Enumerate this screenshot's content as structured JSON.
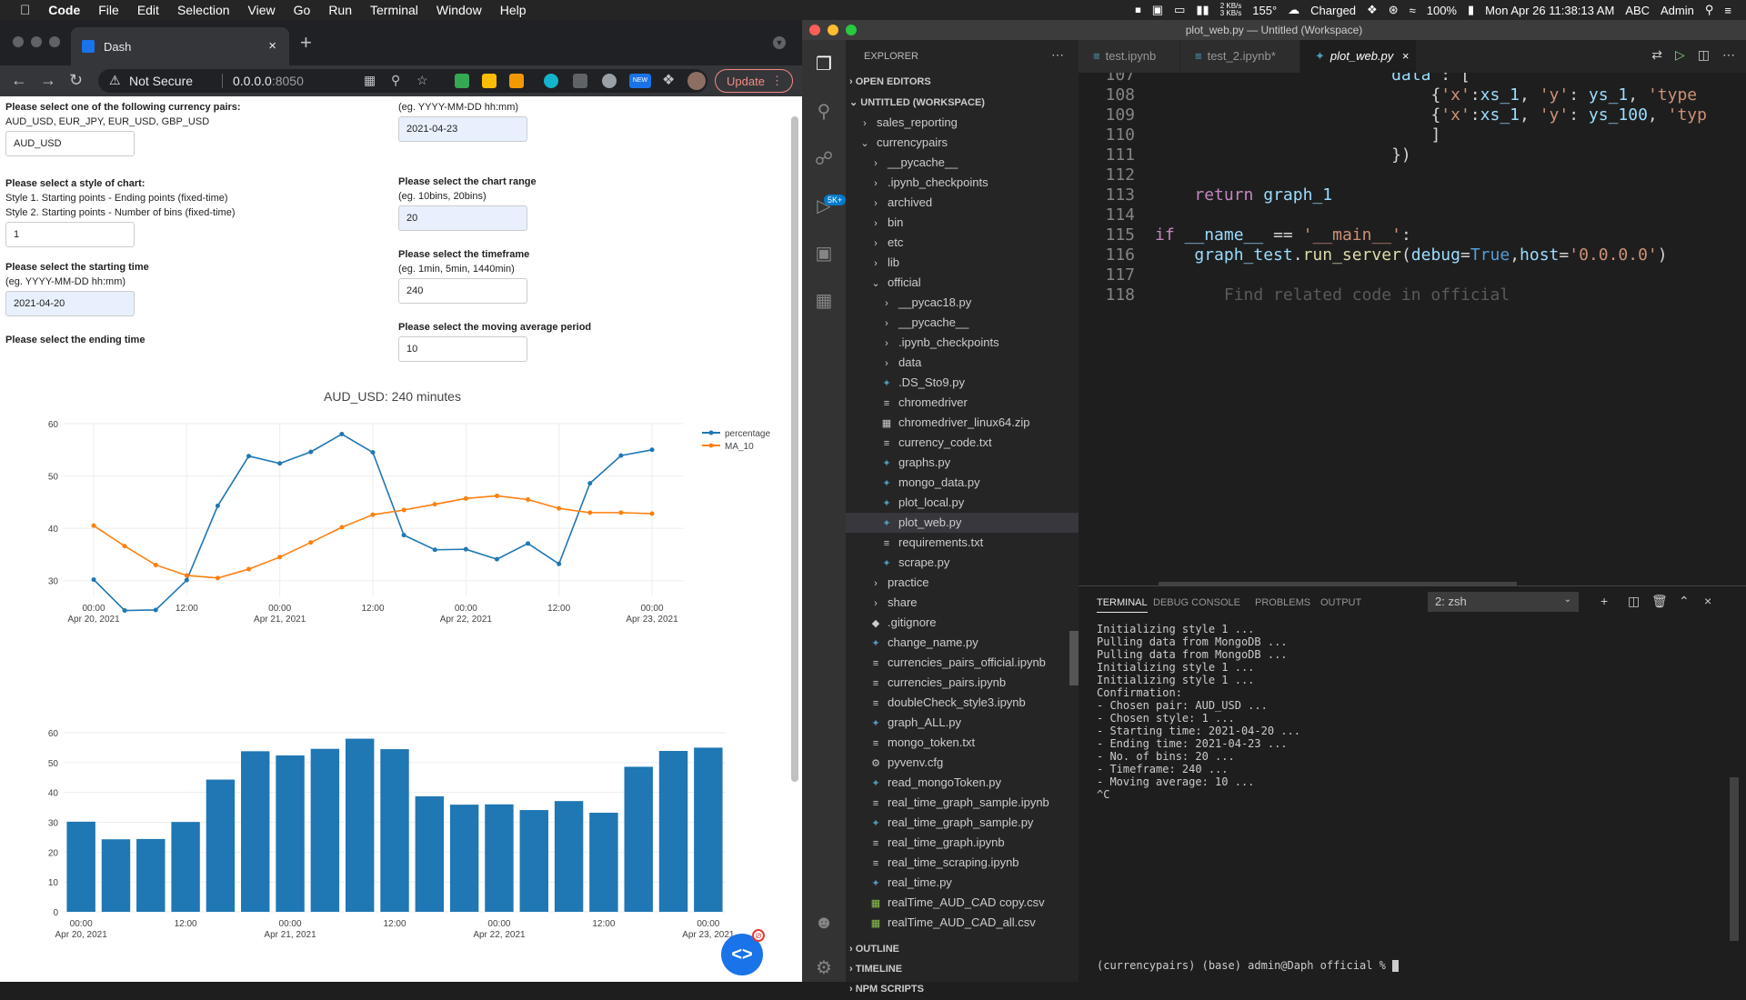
{
  "menubar": {
    "app": "Code",
    "items": [
      "File",
      "Edit",
      "Selection",
      "View",
      "Go",
      "Run",
      "Terminal",
      "Window",
      "Help"
    ],
    "right": {
      "net_up": "2 KB/s",
      "net_down": "3 KB/s",
      "temp": "155°",
      "charged": "Charged",
      "battery": "100%",
      "datetime": "Mon Apr 26  11:38:13 AM",
      "input_source": "ABC",
      "user": "Admin"
    }
  },
  "chrome": {
    "tab_title": "Dash",
    "omnibox": {
      "security": "Not Secure",
      "host": "0.0.0.0",
      "port": ":8050"
    },
    "update_label": "Update",
    "new_badge": "NEW"
  },
  "dash": {
    "currency_label": "Please select one of the following currency pairs:",
    "currency_hint": "AUD_USD, EUR_JPY, EUR_USD, GBP_USD",
    "currency_value": "AUD_USD",
    "style_label": "Please select a style of chart:",
    "style_hint1": "Style 1. Starting points - Ending points (fixed-time)",
    "style_hint2": "Style 2. Starting points - Number of bins (fixed-time)",
    "style_value": "1",
    "start_label": "Please select the starting time",
    "start_hint": "(eg. YYYY-MM-DD hh:mm)",
    "start_value": "2021-04-20",
    "end_label": "Please select the ending time",
    "end_hint": "(eg. YYYY-MM-DD hh:mm)",
    "end_value": "2021-04-23",
    "range_label": "Please select the chart range",
    "range_hint": "(eg. 10bins, 20bins)",
    "range_value": "20",
    "timeframe_label": "Please select the timeframe",
    "timeframe_hint": "(eg. 1min, 5min, 1440min)",
    "timeframe_value": "240",
    "ma_label": "Please select the moving average period",
    "ma_value": "10"
  },
  "chart_data": [
    {
      "type": "line",
      "title": "AUD_USD: 240 minutes",
      "x_hours": [
        "Apr 20 00:00",
        "Apr 20 04:00",
        "Apr 20 08:00",
        "Apr 20 12:00",
        "Apr 20 16:00",
        "Apr 20 20:00",
        "Apr 21 00:00",
        "Apr 21 04:00",
        "Apr 21 08:00",
        "Apr 21 12:00",
        "Apr 21 16:00",
        "Apr 21 20:00",
        "Apr 22 00:00",
        "Apr 22 04:00",
        "Apr 22 08:00",
        "Apr 22 12:00",
        "Apr 22 16:00",
        "Apr 22 20:00",
        "Apr 23 00:00"
      ],
      "series": [
        {
          "name": "percentage",
          "color": "#1f77b4",
          "values": [
            30.2,
            24.3,
            24.4,
            30.1,
            44.3,
            53.8,
            52.4,
            54.6,
            58.0,
            54.5,
            38.7,
            35.9,
            36.0,
            34.1,
            37.1,
            33.2,
            48.6,
            53.9,
            55.0
          ]
        },
        {
          "name": "MA_10",
          "color": "#ff7f0e",
          "values": [
            40.5,
            36.6,
            33.0,
            31.0,
            30.5,
            32.2,
            34.5,
            37.3,
            40.2,
            42.6,
            43.5,
            44.6,
            45.7,
            46.2,
            45.5,
            43.8,
            43.0,
            43.0,
            42.8
          ]
        }
      ],
      "xticks": [
        {
          "top": "00:00",
          "bottom": "Apr 20, 2021"
        },
        {
          "top": "12:00",
          "bottom": ""
        },
        {
          "top": "00:00",
          "bottom": "Apr 21, 2021"
        },
        {
          "top": "12:00",
          "bottom": ""
        },
        {
          "top": "00:00",
          "bottom": "Apr 22, 2021"
        },
        {
          "top": "12:00",
          "bottom": ""
        },
        {
          "top": "00:00",
          "bottom": "Apr 23, 2021"
        }
      ],
      "yticks": [
        30,
        40,
        50,
        60
      ],
      "ylim": [
        27,
        60
      ]
    },
    {
      "type": "bar",
      "color": "#1f77b4",
      "values": [
        30.2,
        24.3,
        24.4,
        30.1,
        44.3,
        53.8,
        52.4,
        54.6,
        58.0,
        54.5,
        38.7,
        35.9,
        36.0,
        34.1,
        37.1,
        33.2,
        48.6,
        53.9,
        55.0
      ],
      "xticks": [
        {
          "top": "00:00",
          "bottom": "Apr 20, 2021"
        },
        {
          "top": "12:00",
          "bottom": ""
        },
        {
          "top": "00:00",
          "bottom": "Apr 21, 2021"
        },
        {
          "top": "12:00",
          "bottom": ""
        },
        {
          "top": "00:00",
          "bottom": "Apr 22, 2021"
        },
        {
          "top": "12:00",
          "bottom": ""
        },
        {
          "top": "00:00",
          "bottom": "Apr 23, 2021"
        }
      ],
      "yticks": [
        0,
        10,
        20,
        30,
        40,
        50,
        60
      ],
      "ylim": [
        0,
        60
      ]
    }
  ],
  "vscode": {
    "window_title": "plot_web.py — Untitled (Workspace)",
    "explorer_title": "EXPLORER",
    "activity_badge": "5K+",
    "sections": {
      "open_editors": "OPEN EDITORS",
      "workspace": "UNTITLED (WORKSPACE)",
      "outline": "OUTLINE",
      "timeline": "TIMELINE",
      "npm": "NPM SCRIPTS"
    },
    "tree": [
      {
        "label": "sales_reporting",
        "kind": "folder",
        "open": false,
        "depth": 1
      },
      {
        "label": "currencypairs",
        "kind": "folder",
        "open": true,
        "depth": 1
      },
      {
        "label": "__pycache__",
        "kind": "folder",
        "open": false,
        "depth": 2
      },
      {
        "label": ".ipynb_checkpoints",
        "kind": "folder",
        "open": false,
        "depth": 2
      },
      {
        "label": "archived",
        "kind": "folder",
        "open": false,
        "depth": 2
      },
      {
        "label": "bin",
        "kind": "folder",
        "open": false,
        "depth": 2
      },
      {
        "label": "etc",
        "kind": "folder",
        "open": false,
        "depth": 2
      },
      {
        "label": "lib",
        "kind": "folder",
        "open": false,
        "depth": 2
      },
      {
        "label": "official",
        "kind": "folder",
        "open": true,
        "depth": 2
      },
      {
        "label": "__pycac18.py",
        "kind": "folder",
        "open": false,
        "depth": 3
      },
      {
        "label": "__pycache__",
        "kind": "folder",
        "open": false,
        "depth": 3
      },
      {
        "label": ".ipynb_checkpoints",
        "kind": "folder",
        "open": false,
        "depth": 3
      },
      {
        "label": "data",
        "kind": "folder",
        "open": false,
        "depth": 3
      },
      {
        "label": ".DS_Sto9.py",
        "kind": "py",
        "depth": 3
      },
      {
        "label": "chromedriver",
        "kind": "txt",
        "depth": 3
      },
      {
        "label": "chromedriver_linux64.zip",
        "kind": "zip",
        "depth": 3
      },
      {
        "label": "currency_code.txt",
        "kind": "txt",
        "depth": 3
      },
      {
        "label": "graphs.py",
        "kind": "py",
        "depth": 3
      },
      {
        "label": "mongo_data.py",
        "kind": "py",
        "depth": 3
      },
      {
        "label": "plot_local.py",
        "kind": "py",
        "depth": 3
      },
      {
        "label": "plot_web.py",
        "kind": "py",
        "depth": 3,
        "selected": true
      },
      {
        "label": "requirements.txt",
        "kind": "txt",
        "depth": 3
      },
      {
        "label": "scrape.py",
        "kind": "py",
        "depth": 3
      },
      {
        "label": "practice",
        "kind": "folder",
        "open": false,
        "depth": 2
      },
      {
        "label": "share",
        "kind": "folder",
        "open": false,
        "depth": 2
      },
      {
        "label": ".gitignore",
        "kind": "git",
        "depth": 2
      },
      {
        "label": "change_name.py",
        "kind": "py",
        "depth": 2
      },
      {
        "label": "currencies_pairs_official.ipynb",
        "kind": "txt",
        "depth": 2
      },
      {
        "label": "currencies_pairs.ipynb",
        "kind": "txt",
        "depth": 2
      },
      {
        "label": "doubleCheck_style3.ipynb",
        "kind": "txt",
        "depth": 2
      },
      {
        "label": "graph_ALL.py",
        "kind": "py",
        "depth": 2
      },
      {
        "label": "mongo_token.txt",
        "kind": "txt",
        "depth": 2
      },
      {
        "label": "pyvenv.cfg",
        "kind": "gear",
        "depth": 2
      },
      {
        "label": "read_mongoToken.py",
        "kind": "py",
        "depth": 2
      },
      {
        "label": "real_time_graph_sample.ipynb",
        "kind": "txt",
        "depth": 2
      },
      {
        "label": "real_time_graph_sample.py",
        "kind": "py",
        "depth": 2
      },
      {
        "label": "real_time_graph.ipynb",
        "kind": "txt",
        "depth": 2
      },
      {
        "label": "real_time_scraping.ipynb",
        "kind": "txt",
        "depth": 2
      },
      {
        "label": "real_time.py",
        "kind": "py",
        "depth": 2
      },
      {
        "label": "realTime_AUD_CAD copy.csv",
        "kind": "csv",
        "depth": 2
      },
      {
        "label": "realTime_AUD_CAD_all.csv",
        "kind": "csv",
        "depth": 2
      }
    ],
    "tabs": [
      {
        "label": "test.ipynb",
        "active": false
      },
      {
        "label": "test_2.ipynb*",
        "active": false
      },
      {
        "label": "plot_web.py",
        "active": true
      }
    ],
    "code_lines": [
      {
        "n": "107",
        "html": "                        <span class='var'>data</span><span class='pn'>': [</span>"
      },
      {
        "n": "108",
        "html": "                            <span class='pn'>{</span><span class='st'>'x'</span><span class='pn'>:</span><span class='var'>xs_1</span><span class='pn'>, </span><span class='st'>'y'</span><span class='pn'>: </span><span class='var'>ys_1</span><span class='pn'>, </span><span class='st'>'type</span>"
      },
      {
        "n": "109",
        "html": "                            <span class='pn'>{</span><span class='st'>'x'</span><span class='pn'>:</span><span class='var'>xs_1</span><span class='pn'>, </span><span class='st'>'y'</span><span class='pn'>: </span><span class='var'>ys_100</span><span class='pn'>, </span><span class='st'>'typ</span>"
      },
      {
        "n": "110",
        "html": "                            <span class='pn'>]</span>"
      },
      {
        "n": "111",
        "html": "                        <span class='pn'>})</span>"
      },
      {
        "n": "112",
        "html": ""
      },
      {
        "n": "113",
        "html": "    <span class='kw'>return</span> <span class='var'>graph_1</span>"
      },
      {
        "n": "114",
        "html": ""
      },
      {
        "n": "115",
        "html": "<span class='kw'>if</span> <span class='var'>__name__</span> <span class='pn'>==</span> <span class='st'>'__main__'</span><span class='pn'>:</span>"
      },
      {
        "n": "116",
        "html": "    <span class='var'>graph_test</span><span class='pn'>.</span><span class='fn'>run_server</span><span class='pn'>(</span><span class='var'>debug</span><span class='pn'>=</span><span class='bl'>True</span><span class='pn'>,</span><span class='var'>host</span><span class='pn'>=</span><span class='st'>'0.0.0.0'</span><span class='pn'>)</span>"
      },
      {
        "n": "117",
        "html": ""
      },
      {
        "n": "118",
        "html": "       <span class='ghost'>Find related code in official</span>"
      }
    ],
    "panel_tabs": [
      "TERMINAL",
      "DEBUG CONSOLE",
      "PROBLEMS",
      "OUTPUT"
    ],
    "terminal_select": "2: zsh",
    "terminal_lines": [
      "Initializing style 1 ...",
      "Pulling data from MongoDB ...",
      "Pulling data from MongoDB ...",
      "Initializing style 1 ...",
      "Initializing style 1 ...",
      "Confirmation:",
      "- Chosen pair: AUD_USD ...",
      "- Chosen style: 1 ...",
      "- Starting time: 2021-04-20 ...",
      "- Ending time: 2021-04-23 ...",
      "- No. of bins: 20 ...",
      "- Timeframe: 240 ...",
      "- Moving average: 10 ...",
      "^C"
    ],
    "terminal_prompt": "(currencypairs) (base) admin@Daph official % "
  }
}
